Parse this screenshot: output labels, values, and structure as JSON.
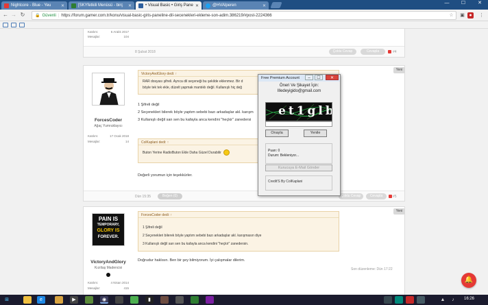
{
  "browser": {
    "tabs": [
      {
        "label": "Nightcore - Blue - Yeu",
        "fav": "#e53935",
        "active": false
      },
      {
        "label": "[SKYfetkili Menüsü - birç",
        "fav": "#2e7d32",
        "active": false
      },
      {
        "label": "• Visual Basic • Giriş Pane",
        "fav": "#2e5f9e",
        "active": true
      },
      {
        "label": "@HVAlperen",
        "fav": "#1da1f2",
        "active": false
      }
    ],
    "security_label": "Güvenli",
    "url": "https://forum.gamer.com.tr/konu/visual-basic-giris-paneline-dil-secenekleri-ekleme-son-adim.386219/#post-2224366",
    "window_controls": [
      "—",
      "☐",
      "✕"
    ]
  },
  "top_post": {
    "stats": [
      {
        "label": "Katılım:",
        "value": "6 Aralık 2017"
      },
      {
        "label": "Mesajlar:",
        "value": "104"
      }
    ],
    "date": "8 Şubat 2018",
    "quote_btn": "Çoklu Cevap",
    "reply_btn": "Cevapla",
    "num": "#4"
  },
  "post_a": {
    "badge": "Yeni",
    "username": "ForcesCoder",
    "user_title": "Ağaç Yumruklayıcı",
    "stats": [
      {
        "label": "Katılım:",
        "value": "17 Ocak 2018"
      },
      {
        "label": "Mesajlar:",
        "value": "14"
      }
    ],
    "quote1_head": "VictoryAndGlory dedi: ↑",
    "quote1_lines": [
      "RAR dosyası şifreli. Ayrıca dil seçeneği bu şekilde eklenmez. Bir d",
      "böyle tek tek ekle, düzelt yapmak mantıklı değil. Kullanışlı hiç değ"
    ],
    "list_lines": [
      "1 Şifreli değil",
      "2 Seçenekleri bilerek böyle yaptım sebebi bazı arkadaşlar akl. karışm",
      "3 Kullanışlı değil san sen bu kafayla anca kendini \"heçkir\" zanedersi"
    ],
    "quote2_head": "ColKaplani dedi: ↑",
    "quote2_line": "Buton Yerine RadioButon Ekle Daha Güzel Durabilir",
    "reply_text": "Değerli yorumun için teşekkürler.",
    "date": "Dün 15:35",
    "like_btn": "Beğen (0)",
    "quote_btn": "Çoklu Cevap",
    "reply_btn": "Cevapla",
    "num": "#5"
  },
  "post_b": {
    "badge": "Yeni",
    "avatar_lines": [
      "PAIN IS",
      "TEMPORARY,",
      "GLORY IS",
      "FOREVER."
    ],
    "username": "VictoryAndGlory",
    "user_title": "Kızıltaş Madencisi",
    "stats": [
      {
        "label": "Katılım:",
        "value": "4 Nisan 2014"
      },
      {
        "label": "Mesajlar:",
        "value": "415"
      }
    ],
    "quote_head": "ForcesCoder dedi: ↑",
    "quote_lines": [
      "1 Şifreli değil",
      "2 Seçenekleri bilerek böyle yaptım sebebi bazı arkadaşlar akl. karışmasın diye",
      "3 Kullanışlı değil san sen bu kafayla anca kendini \"heçkir\" zanedersin."
    ],
    "body": "Doğrudur haklısın. Ben bir şey bilmiyorum. İyi çalışmalar dilerim.",
    "edited": "Son düzenleme: Dün 17:22"
  },
  "app_window": {
    "title": "Free Premium Account",
    "heading1": "Öneri Ve Şikayet İçin:",
    "heading2": "Illedeyigido@gmail.com",
    "captcha_text": "et1glb",
    "approve_btn": "Onayla",
    "refresh_btn": "Yenile",
    "points_label": "Puan: 0",
    "status_label": "Durum: Bekleniyor...",
    "mail_btn": "Kurucuya E-Mail Gönder",
    "credit": "Credit'S By ColKaplani"
  },
  "taskbar": {
    "clock": "16:26"
  }
}
